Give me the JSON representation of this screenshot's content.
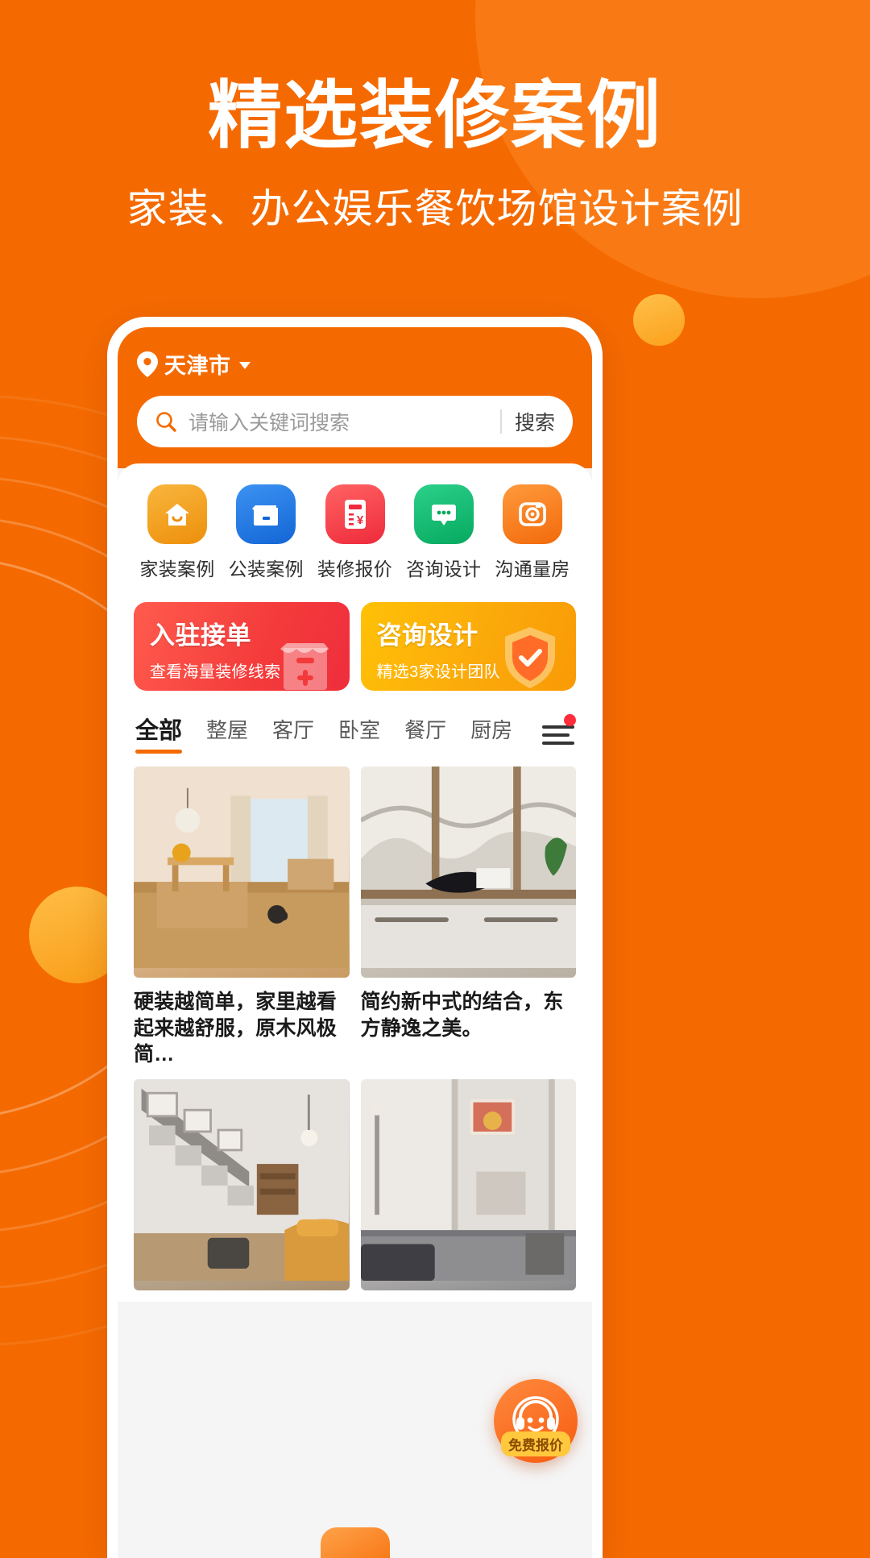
{
  "hero": {
    "title": "精选装修案例",
    "subtitle": "家装、办公娱乐餐饮场馆设计案例"
  },
  "colors": {
    "brand_orange": "#F56A00",
    "banner_red": "#F43B3B",
    "banner_amber": "#FBA80B",
    "badge_red": "#FF2D3C"
  },
  "app": {
    "location": {
      "name": "天津市",
      "pin_icon": "location-pin-icon",
      "caret_icon": "chevron-down-icon"
    },
    "search": {
      "placeholder": "请输入关键词搜索",
      "button_label": "搜索",
      "icon": "search-icon"
    },
    "quicknav": [
      {
        "label": "家装案例",
        "icon": "home-icon",
        "color": "#F5A623"
      },
      {
        "label": "公装案例",
        "icon": "storefront-icon",
        "color": "#1A7BEB"
      },
      {
        "label": "装修报价",
        "icon": "calculator-icon",
        "color": "#F5414F"
      },
      {
        "label": "咨询设计",
        "icon": "chat-bubble-icon",
        "color": "#0CB76A"
      },
      {
        "label": "沟通量房",
        "icon": "tape-measure-icon",
        "color": "#F5821F"
      }
    ],
    "banners": [
      {
        "title": "入驻接单",
        "subtitle": "查看海量装修线索",
        "art_icon": "shop-icon",
        "theme": "red"
      },
      {
        "title": "咨询设计",
        "subtitle": "精选3家设计团队",
        "art_icon": "shield-check-icon",
        "theme": "amber"
      }
    ],
    "tabs": [
      {
        "label": "全部",
        "active": true
      },
      {
        "label": "整屋",
        "active": false
      },
      {
        "label": "客厅",
        "active": false
      },
      {
        "label": "卧室",
        "active": false
      },
      {
        "label": "餐厅",
        "active": false
      },
      {
        "label": "厨房",
        "active": false
      }
    ],
    "tabs_more_icon": "hamburger-menu-icon",
    "tabs_more_badge": true,
    "cards": [
      {
        "title": "硬装越简单，家里越看起来越舒服，原木风极简…",
        "photo": "living-dining-room"
      },
      {
        "title": "简约新中式的结合，东方静逸之美。",
        "photo": "chinese-style-console"
      },
      {
        "title": "",
        "photo": "staircase-loft-living"
      },
      {
        "title": "",
        "photo": "modern-hallway"
      }
    ],
    "fab": {
      "icon": "customer-service-icon",
      "label": "免费报价"
    }
  }
}
